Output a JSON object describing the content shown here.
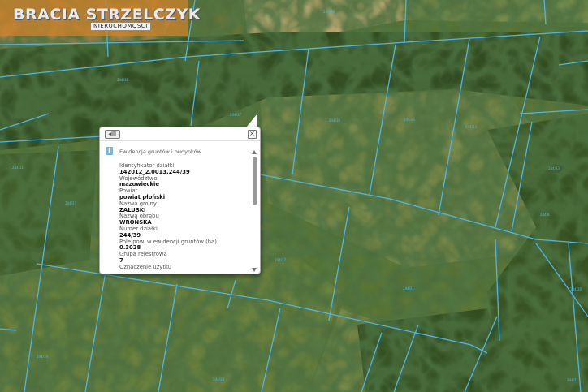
{
  "logo": {
    "main": "BRACIA STRZELCZYK",
    "sub": "NIERUCHOMOŚCI"
  },
  "popup": {
    "back_icon": "back-arrow-icon",
    "close_icon": "close-icon",
    "source": "Ewidencja gruntów i budynków",
    "fields": [
      {
        "label": "Identyfikator działki",
        "value": "142012_2.0013.244/39"
      },
      {
        "label": "Województwo",
        "value": "mazowieckie"
      },
      {
        "label": "Powiat",
        "value": "powiat płoński"
      },
      {
        "label": "Nazwa gminy",
        "value": "ZAŁUSKI"
      },
      {
        "label": "Nazwa obrębu",
        "value": "WROŃSKA"
      },
      {
        "label": "Numer działki",
        "value": "244/39"
      },
      {
        "label": "Pole pow. w ewidencji gruntów (ha)",
        "value": "0.3028"
      },
      {
        "label": "Grupa rejestrowa",
        "value": "7"
      },
      {
        "label": "Oznaczenie użytku",
        "value": ""
      }
    ]
  },
  "colors": {
    "parcel_line": "#4fb4e8",
    "logo_bg": "#d2822899"
  },
  "parcels": [
    "244/40",
    "244/38",
    "244/37",
    "244/36",
    "244/35",
    "244/34",
    "244/33",
    "244/31",
    "244/27",
    "244/22",
    "244/21",
    "244/20",
    "244/19",
    "244/18",
    "244/8",
    "244/7"
  ]
}
